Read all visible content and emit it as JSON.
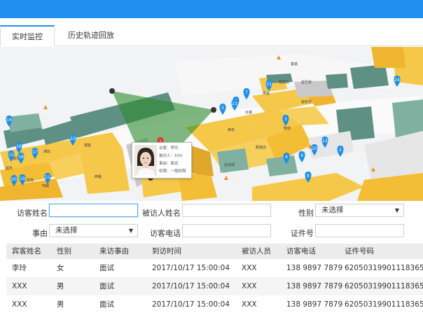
{
  "tabs": [
    {
      "label": "实时监控",
      "active": true
    },
    {
      "label": "历史轨迹回放",
      "active": false
    }
  ],
  "map": {
    "pins": [
      "1",
      "2",
      "3",
      "4",
      "5",
      "6",
      "7",
      "8",
      "9",
      "10",
      "11",
      "12",
      "13",
      "14",
      "15",
      "16",
      "17",
      "18",
      "19",
      "20",
      "21",
      "22",
      "23",
      "24"
    ],
    "labels": [
      "钢琴",
      "潮玩",
      "超市",
      "银座",
      "电器",
      "西餐",
      "咖啡",
      "书店",
      "美妆",
      "女装",
      "男装",
      "鞋城",
      "星巴克",
      "面包坊",
      "服装店",
      "眼镜店",
      "童装",
      "运动城",
      "影院"
    ],
    "popup": {
      "name": "访客：李玲",
      "host": "被访人：XXX",
      "reason": "事由：面试",
      "auth": "权限：一般权限"
    },
    "block_number": "3"
  },
  "form": {
    "visitor_name_label": "访客姓名",
    "visitor_name_value": "",
    "host_name_label": "被访人姓名",
    "host_name_value": "",
    "gender_label": "性别",
    "gender_value": "未选择",
    "reason_label": "事由",
    "reason_value": "未选择",
    "visitor_phone_label": "访客电话",
    "visitor_phone_value": "",
    "id_label": "证件号",
    "id_value": ""
  },
  "table": {
    "headers": [
      "宾客姓名",
      "性别",
      "来访事由",
      "到访时间",
      "被访人员",
      "访客电话",
      "证件号码"
    ],
    "rows": [
      [
        "李玲",
        "女",
        "面试",
        "2017/10/17 15:00:04",
        "XXX",
        "138 9897 7879",
        "620503199011183655"
      ],
      [
        "XXX",
        "男",
        "面试",
        "2017/10/17 15:00:04",
        "XXX",
        "138 9897 7879",
        "620503199011183655"
      ],
      [
        "XXX",
        "男",
        "面试",
        "2017/10/17 15:00:04",
        "XXX",
        "138 9897 7879",
        "620503199011183655"
      ]
    ]
  },
  "colors": {
    "accent": "#1f8ff0",
    "building_yellow": "#f5c84a",
    "building_green": "#7fb0a0",
    "pin_blue": "#1e8fe6",
    "pin_red": "#e0352b",
    "cone_green": "#2f8a2f"
  }
}
